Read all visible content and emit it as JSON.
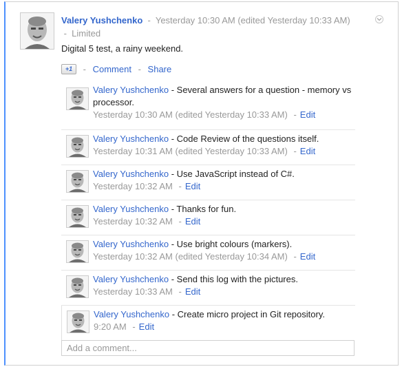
{
  "post": {
    "author": "Valery Yushchenko",
    "meta": "Yesterday 10:30 AM (edited Yesterday 10:33 AM)",
    "visibility": "Limited",
    "text": "Digital 5 test, a rainy weekend.",
    "plusone_label": "+1",
    "comment_label": "Comment",
    "share_label": "Share",
    "separator": "-"
  },
  "comments": [
    {
      "author": "Valery Yushchenko",
      "text": " - Several answers for a question - memory vs processor.",
      "time": "Yesterday 10:30 AM (edited Yesterday 10:33 AM)",
      "edit": "Edit"
    },
    {
      "author": "Valery Yushchenko",
      "text": " - Code Review of the questions itself.",
      "time": "Yesterday 10:31 AM (edited Yesterday 10:33 AM)",
      "edit": "Edit"
    },
    {
      "author": "Valery Yushchenko",
      "text": " - Use JavaScript instead of C#.",
      "time": "Yesterday 10:32 AM",
      "edit": "Edit"
    },
    {
      "author": "Valery Yushchenko",
      "text": " - Thanks for fun.",
      "time": "Yesterday 10:32 AM",
      "edit": "Edit"
    },
    {
      "author": "Valery Yushchenko",
      "text": " - Use bright colours (markers).",
      "time": "Yesterday 10:32 AM (edited Yesterday 10:34 AM)",
      "edit": "Edit"
    },
    {
      "author": "Valery Yushchenko",
      "text": " - Send this log with the pictures.",
      "time": "Yesterday 10:33 AM",
      "edit": "Edit"
    },
    {
      "author": "Valery Yushchenko",
      "text": " - Create micro project in Git repository.",
      "time": "9:20 AM",
      "edit": "Edit"
    }
  ],
  "add_comment_placeholder": "Add a comment...",
  "colors": {
    "link": "#3366cc",
    "meta": "#999999",
    "accent_border": "#4d90fe"
  },
  "icons": [
    "avatar-photo",
    "chevron-down-icon",
    "plus-one-icon"
  ]
}
